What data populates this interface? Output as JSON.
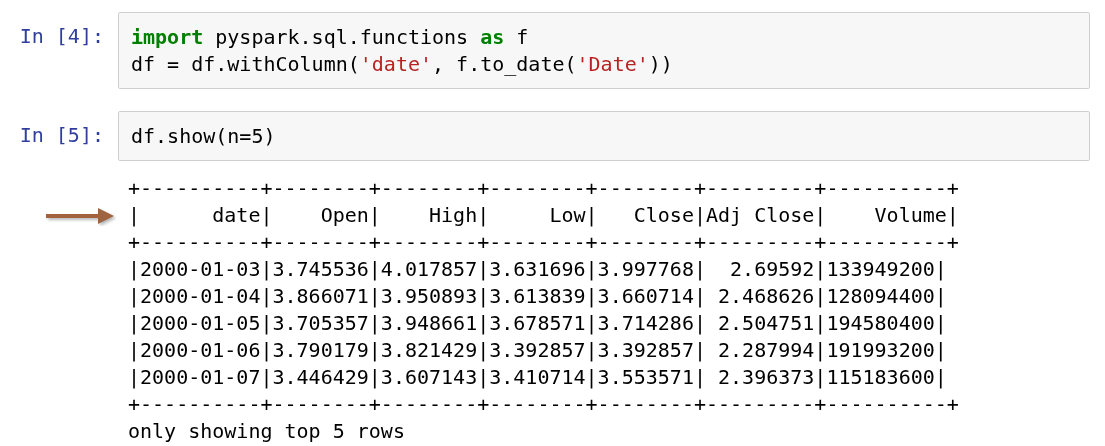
{
  "cells": [
    {
      "prompt": "In [4]:",
      "code": [
        [
          {
            "kind": "keyword",
            "text": "import"
          },
          {
            "kind": "plain",
            "text": " pyspark.sql.functions "
          },
          {
            "kind": "keyword",
            "text": "as"
          },
          {
            "kind": "plain",
            "text": " f"
          }
        ],
        [
          {
            "kind": "plain",
            "text": "df = df.withColumn("
          },
          {
            "kind": "string",
            "text": "'date'"
          },
          {
            "kind": "plain",
            "text": ", f.to_date("
          },
          {
            "kind": "string",
            "text": "'Date'"
          },
          {
            "kind": "plain",
            "text": "))"
          }
        ]
      ]
    },
    {
      "prompt": "In [5]:",
      "code": [
        [
          {
            "kind": "plain",
            "text": "df.show(n=5)"
          }
        ]
      ],
      "output": [
        {
          "text": "+----------+--------+--------+--------+--------+---------+----------+",
          "arrow": false
        },
        {
          "text": "|      date|    Open|    High|     Low|   Close|Adj Close|    Volume|",
          "arrow": true
        },
        {
          "text": "+----------+--------+--------+--------+--------+---------+----------+",
          "arrow": false
        },
        {
          "text": "|2000-01-03|3.745536|4.017857|3.631696|3.997768|  2.69592|133949200|",
          "arrow": false
        },
        {
          "text": "|2000-01-04|3.866071|3.950893|3.613839|3.660714| 2.468626|128094400|",
          "arrow": false
        },
        {
          "text": "|2000-01-05|3.705357|3.948661|3.678571|3.714286| 2.504751|194580400|",
          "arrow": false
        },
        {
          "text": "|2000-01-06|3.790179|3.821429|3.392857|3.392857| 2.287994|191993200|",
          "arrow": false
        },
        {
          "text": "|2000-01-07|3.446429|3.607143|3.410714|3.553571| 2.396373|115183600|",
          "arrow": false
        },
        {
          "text": "+----------+--------+--------+--------+--------+---------+----------+",
          "arrow": false
        },
        {
          "text": "only showing top 5 rows",
          "arrow": false
        }
      ]
    }
  ]
}
